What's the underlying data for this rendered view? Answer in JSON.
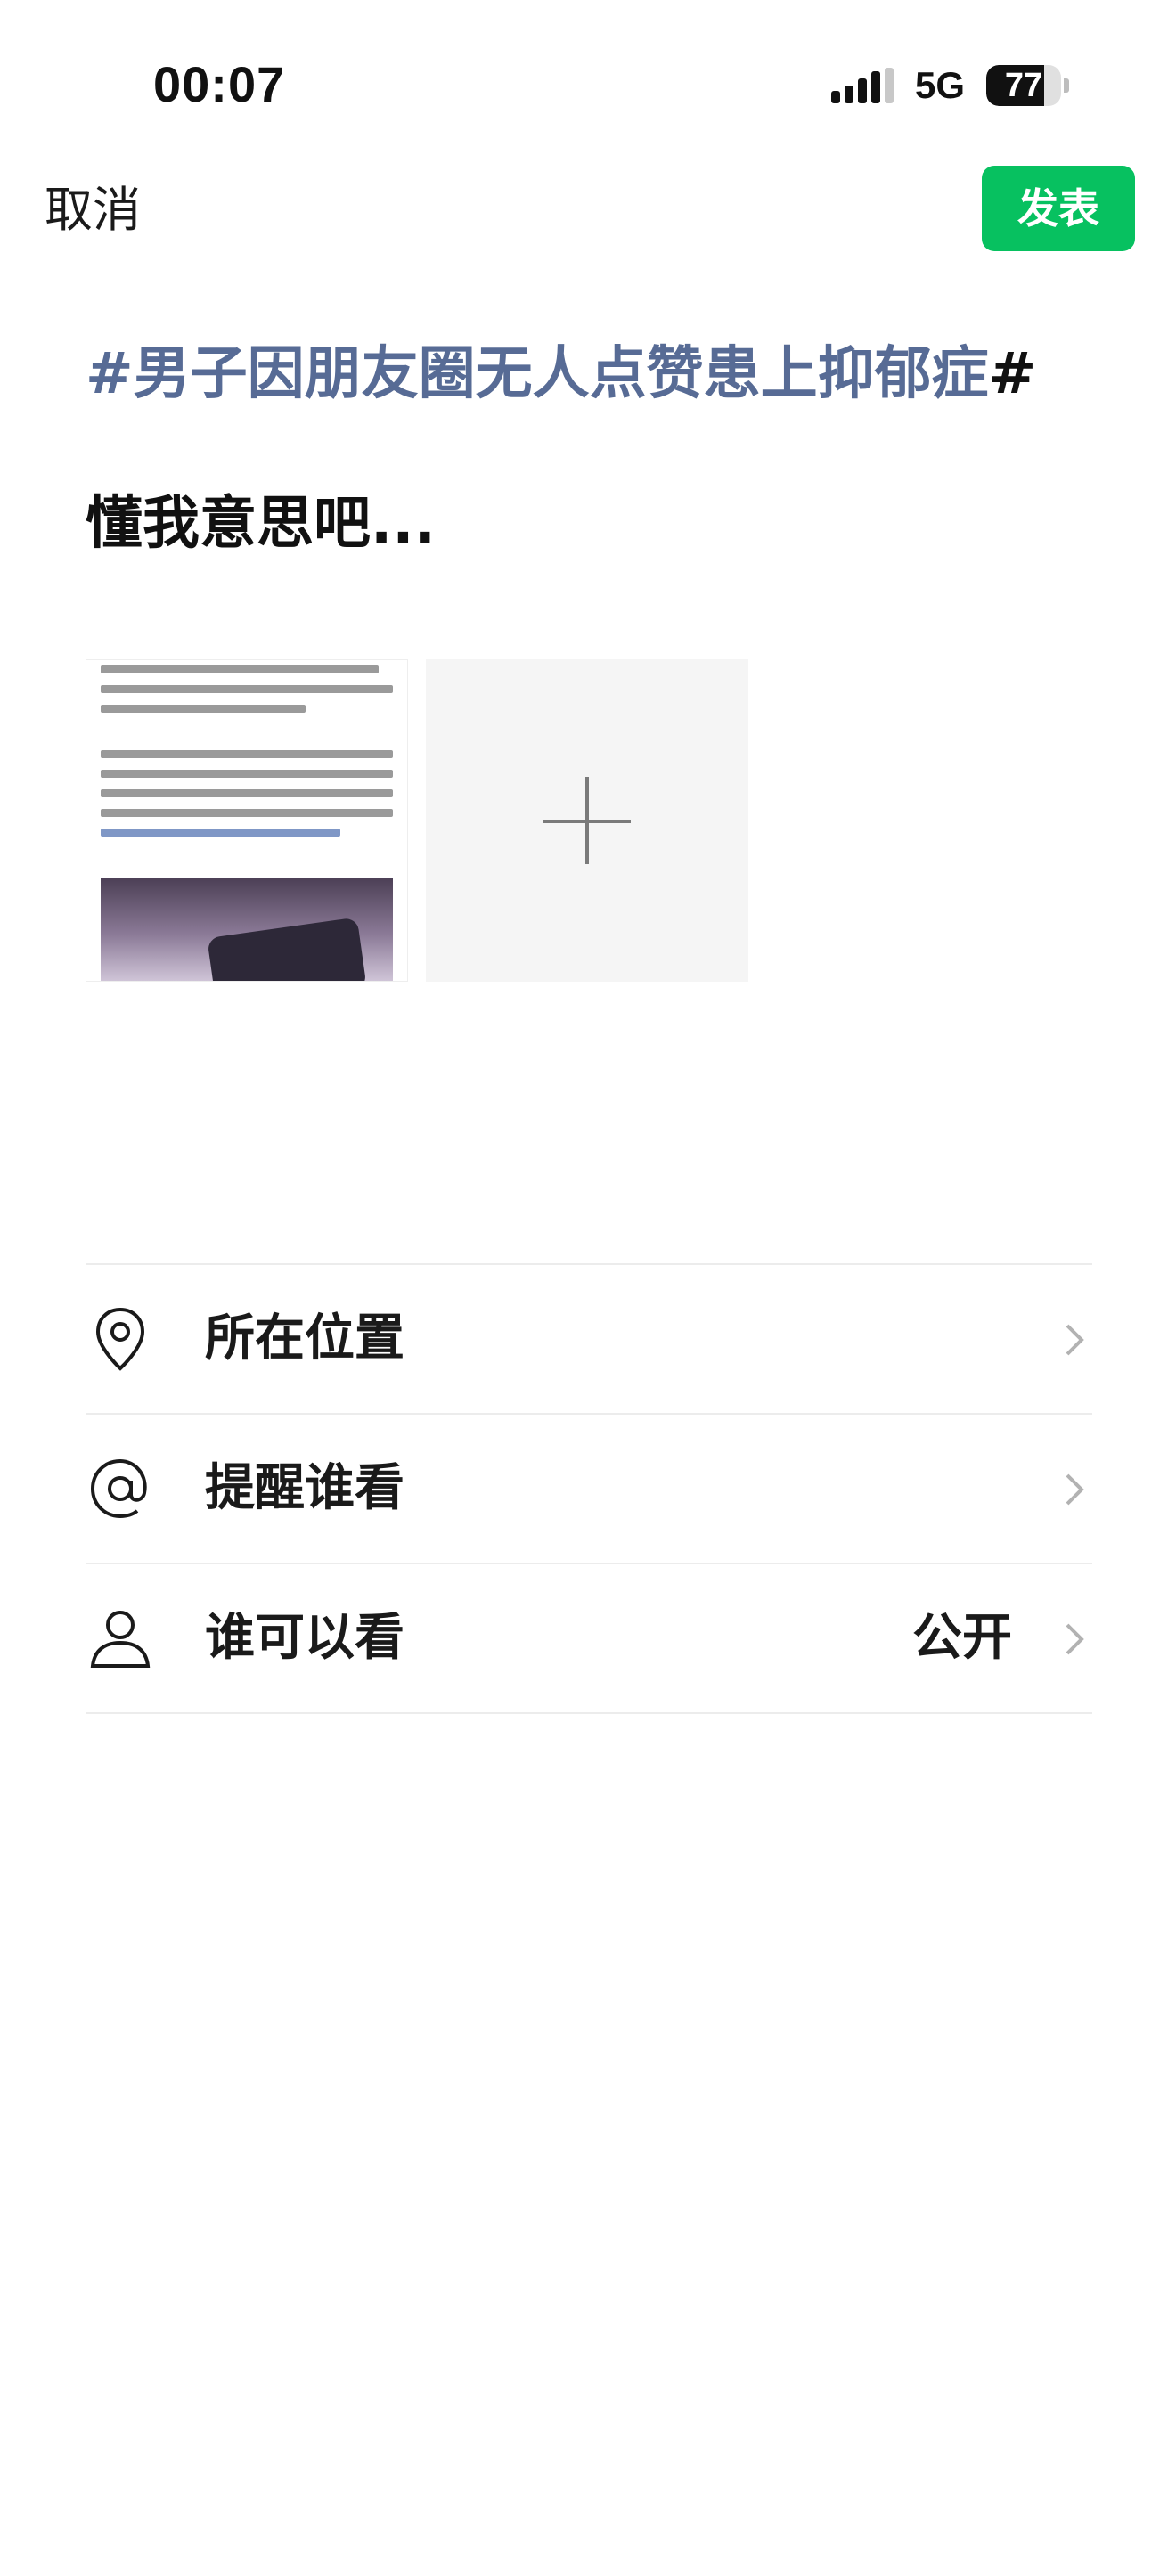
{
  "status_bar": {
    "time": "00:07",
    "network": "5G",
    "battery_level": "77"
  },
  "header": {
    "cancel_label": "取消",
    "publish_label": "发表"
  },
  "post": {
    "topic": "#男子因朋友圈无人点赞患上抑郁症",
    "topic_end": "#",
    "body": "懂我意思吧..."
  },
  "attachments": {
    "image_alt": "新闻截图",
    "add_icon": "plus-icon"
  },
  "options": [
    {
      "icon": "location-pin-icon",
      "label": "所在位置",
      "value": ""
    },
    {
      "icon": "at-sign-icon",
      "label": "提醒谁看",
      "value": ""
    },
    {
      "icon": "person-icon",
      "label": "谁可以看",
      "value": "公开"
    }
  ],
  "colors": {
    "accent": "#07c160",
    "topic_link": "#576b95"
  }
}
